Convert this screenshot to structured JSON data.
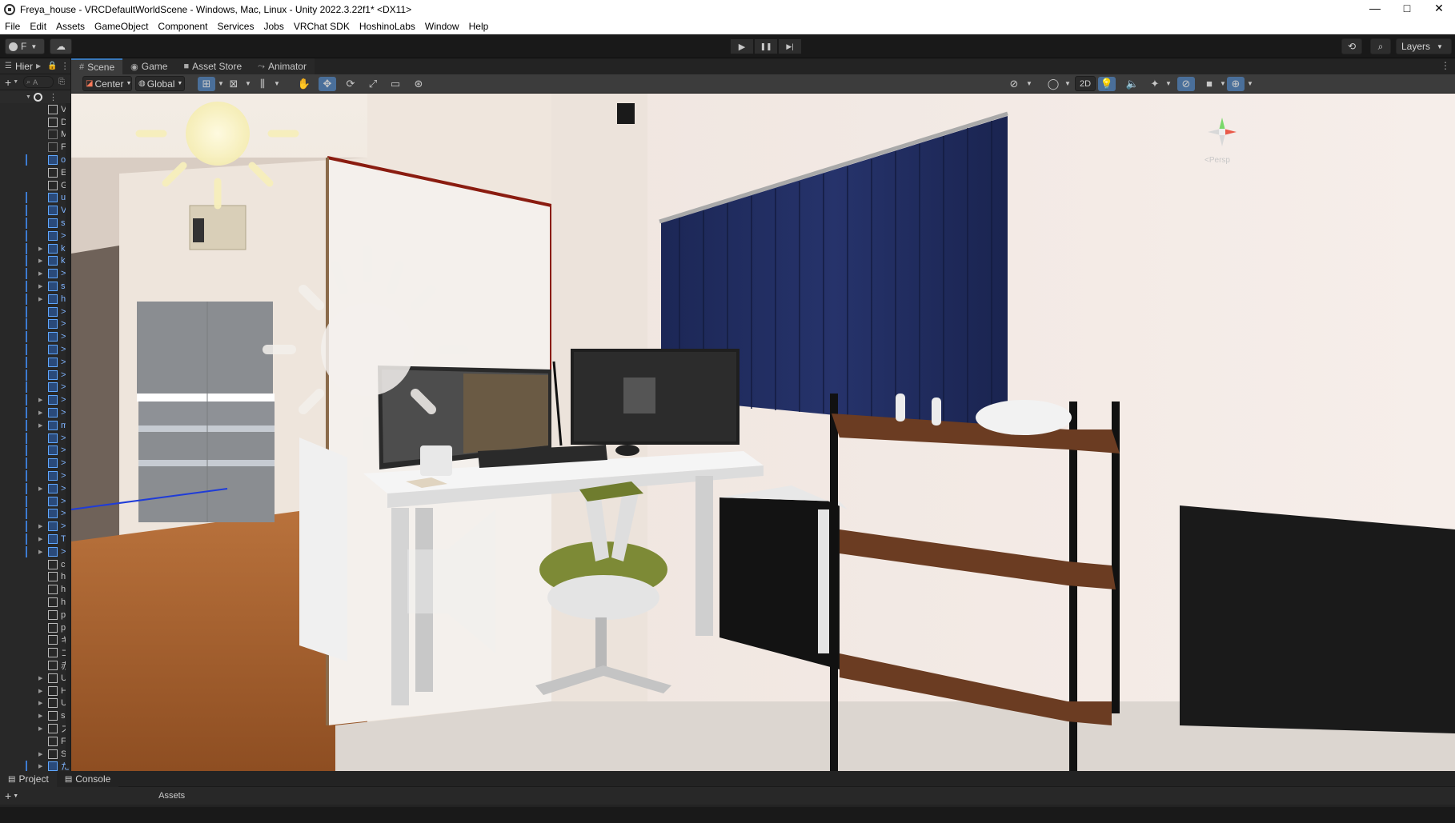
{
  "window": {
    "title": "Freya_house - VRCDefaultWorldScene - Windows, Mac, Linux - Unity 2022.3.22f1* <DX11>",
    "minimize": "—",
    "maximize": "□",
    "close": "✕"
  },
  "menu": [
    "File",
    "Edit",
    "Assets",
    "GameObject",
    "Component",
    "Services",
    "Jobs",
    "VRChat SDK",
    "HoshinoLabs",
    "Window",
    "Help"
  ],
  "toolbar": {
    "account_label": "F",
    "layers_label": "Layers",
    "play_icon": "▶",
    "pause_icon": "❚❚",
    "step_icon": "▶|"
  },
  "hierarchy": {
    "tab_label": "Hier",
    "search_placeholder": "A",
    "rows": [
      {
        "label": "V",
        "type": "cube",
        "arrow": ""
      },
      {
        "label": "D",
        "type": "cube",
        "arrow": ""
      },
      {
        "label": "M",
        "type": "gray",
        "arrow": ""
      },
      {
        "label": "F",
        "type": "gray",
        "arrow": ""
      },
      {
        "label": "o",
        "type": "blue",
        "arrow": ""
      },
      {
        "label": "E",
        "type": "cube",
        "arrow": ""
      },
      {
        "label": "G",
        "type": "cube",
        "arrow": ""
      },
      {
        "label": "u",
        "type": "blue",
        "arrow": ""
      },
      {
        "label": "V",
        "type": "blue",
        "arrow": ""
      },
      {
        "label": "s",
        "type": "blue",
        "arrow": ""
      },
      {
        "label": ">",
        "type": "blue",
        "arrow": ""
      },
      {
        "label": "k",
        "type": "blue",
        "arrow": "▶"
      },
      {
        "label": "k",
        "type": "blue",
        "arrow": "▶"
      },
      {
        "label": ">",
        "type": "blue",
        "arrow": "▶"
      },
      {
        "label": "s",
        "type": "blue",
        "arrow": "▶"
      },
      {
        "label": "h",
        "type": "blue",
        "arrow": "▶"
      },
      {
        "label": ">",
        "type": "blue",
        "arrow": ""
      },
      {
        "label": ">",
        "type": "blue",
        "arrow": ""
      },
      {
        "label": ">",
        "type": "blue",
        "arrow": ""
      },
      {
        "label": ">",
        "type": "blue",
        "arrow": ""
      },
      {
        "label": ">",
        "type": "blue",
        "arrow": ""
      },
      {
        "label": ">",
        "type": "blue",
        "arrow": ""
      },
      {
        "label": ">",
        "type": "blue",
        "arrow": ""
      },
      {
        "label": ">",
        "type": "blue",
        "arrow": "▶"
      },
      {
        "label": ">",
        "type": "blue",
        "arrow": "▶"
      },
      {
        "label": "m",
        "type": "blue",
        "arrow": "▶"
      },
      {
        "label": ">",
        "type": "blue",
        "arrow": ""
      },
      {
        "label": ">",
        "type": "blue",
        "arrow": ""
      },
      {
        "label": ">",
        "type": "blue",
        "arrow": ""
      },
      {
        "label": ">",
        "type": "blue",
        "arrow": ""
      },
      {
        "label": ">",
        "type": "blue",
        "arrow": "▶"
      },
      {
        "label": ">",
        "type": "blue",
        "arrow": ""
      },
      {
        "label": ">",
        "type": "blue",
        "arrow": ""
      },
      {
        "label": ">",
        "type": "blue",
        "arrow": "▶"
      },
      {
        "label": "T",
        "type": "blue",
        "arrow": "▶"
      },
      {
        "label": ">",
        "type": "blue",
        "arrow": "▶"
      },
      {
        "label": "c",
        "type": "cube",
        "arrow": ""
      },
      {
        "label": "h",
        "type": "cube",
        "arrow": ""
      },
      {
        "label": "h",
        "type": "cube",
        "arrow": ""
      },
      {
        "label": "h",
        "type": "cube",
        "arrow": ""
      },
      {
        "label": "p",
        "type": "cube",
        "arrow": ""
      },
      {
        "label": "p",
        "type": "cube",
        "arrow": ""
      },
      {
        "label": "キ",
        "type": "cube",
        "arrow": ""
      },
      {
        "label": "コ",
        "type": "cube",
        "arrow": ""
      },
      {
        "label": "赤",
        "type": "cube",
        "arrow": ""
      },
      {
        "label": "U",
        "type": "cube",
        "arrow": "▶"
      },
      {
        "label": "H",
        "type": "cube",
        "arrow": "▶"
      },
      {
        "label": "U",
        "type": "cube",
        "arrow": "▶"
      },
      {
        "label": "s",
        "type": "cube",
        "arrow": "▶"
      },
      {
        "label": "ス",
        "type": "cube",
        "arrow": "▶"
      },
      {
        "label": "F",
        "type": "cube",
        "arrow": ""
      },
      {
        "label": "S",
        "type": "cube",
        "arrow": "▶"
      },
      {
        "label": "た",
        "type": "blue",
        "arrow": "▶"
      }
    ]
  },
  "scene_tabs": [
    {
      "label": "Scene",
      "icon": "#",
      "active": true
    },
    {
      "label": "Game",
      "icon": "◉",
      "active": false
    },
    {
      "label": "Asset Store",
      "icon": "■",
      "active": false
    },
    {
      "label": "Animator",
      "icon": "⤳",
      "active": false
    }
  ],
  "scene_toolbar": {
    "pivot_label": "Center",
    "space_label": "Global",
    "mode_2d": "2D",
    "persp_label": "<Persp"
  },
  "bottom": {
    "tabs": [
      {
        "label": "Project",
        "icon": "▤"
      },
      {
        "label": "Console",
        "icon": "▤"
      }
    ],
    "add_label": "+",
    "assets_label": "Assets"
  },
  "colors": {
    "accent": "#3a79bb",
    "curtain": "#1f2a55",
    "selection_blue": "#5fa7ff"
  }
}
